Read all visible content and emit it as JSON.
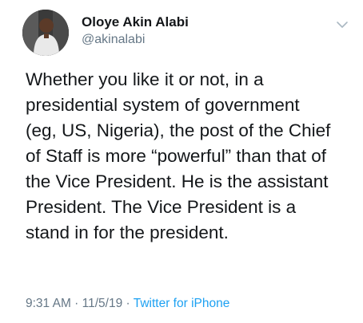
{
  "author": {
    "display_name": "Oloye Akin Alabi",
    "handle": "@akinalabi"
  },
  "menu_icon": "chevron-down-icon",
  "tweet": {
    "lines": [
      "Whether you like it or not, in a",
      "presidential system of government",
      "(eg, US, Nigeria), the post of the Chief",
      "of Staff is more “powerful” than that of",
      "the Vice President. He is the assistant",
      "President. The Vice President is a",
      "stand in for the president."
    ]
  },
  "meta": {
    "time": "9:31 AM",
    "separator": " · ",
    "date": "11/5/19",
    "source": "Twitter for iPhone"
  },
  "colors": {
    "text": "#14171a",
    "secondary": "#657786",
    "link": "#1da1f2"
  }
}
